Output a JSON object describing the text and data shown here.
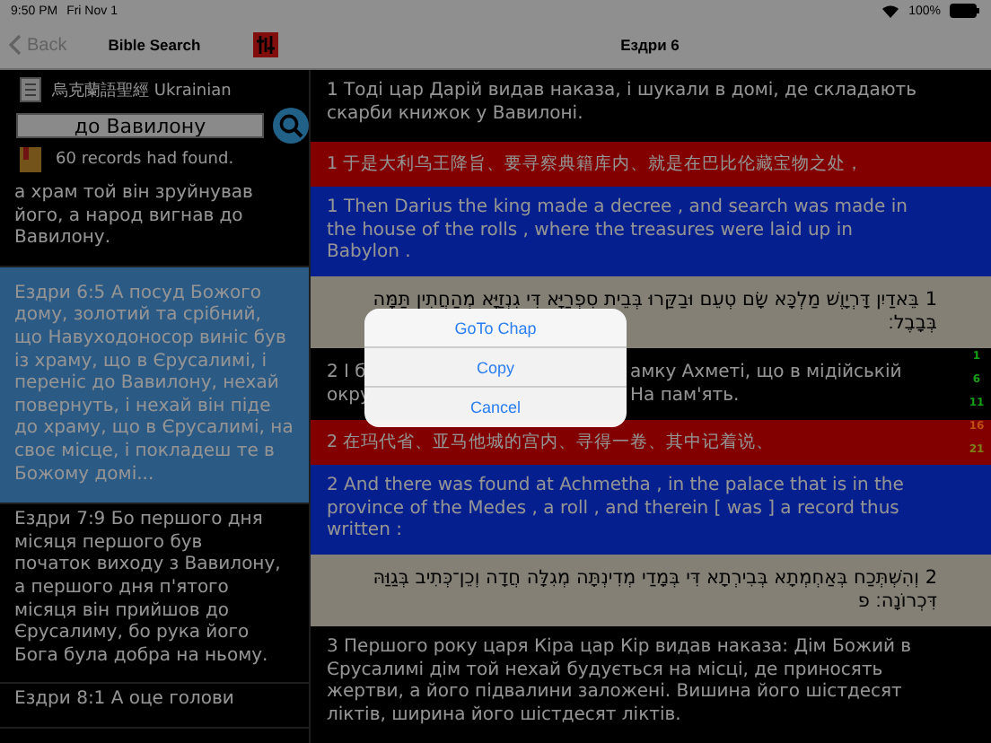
{
  "status_bar": {
    "time": "9:50 PM",
    "date": "Fri Nov 1",
    "battery": "100%"
  },
  "nav": {
    "back": "Back",
    "left_title": "Bible Search",
    "right_title": "Ездри 6"
  },
  "search": {
    "version": "烏克蘭語聖經 Ukrainian",
    "query": "до Вавилону",
    "result_count": "60 records had found."
  },
  "results": [
    {
      "text": "а храм той він зруйнував його, а народ вигнав до Вавилону.",
      "selected": false
    },
    {
      "text": "Ездри 6:5 А посуд Божого дому, золотий та срібний, що Навуходоносор виніс був із храму, що в Єрусалимі, і переніс до Вавилону, нехай повернуть, і нехай він піде до храму, що в Єрусалимі, на своє місце, і покладеш те в Божому домі...",
      "selected": true
    },
    {
      "text": "Ездри 7:9 Бо першого дня місяця першого був початок виходу з Вавилону, а першого дня п'ятого місяця він прийшов до Єрусалиму, бо рука його Бога була добра на ньому.",
      "selected": false
    },
    {
      "text": "Ездри 8:1 А оце голови",
      "selected": false
    }
  ],
  "verses": [
    {
      "kind": "ukrainian",
      "text": "1 Тоді цар Дарій видав наказа, і шукали в домі, де складають скарби книжок у Вавилоні."
    },
    {
      "kind": "chinese",
      "text": "1 于是大利乌王降旨、要寻察典籍库内、就是在巴比伦藏宝物之处，"
    },
    {
      "kind": "english",
      "text": "1 Then Darius the king made a decree , and search was made in the house of the rolls , where the treasures were laid up in Babylon ."
    },
    {
      "kind": "hebrew",
      "text": "1 בֵּאדַיִן דָּרְיָוֶשׁ מַלְכָּא שָׂם טְעֵם וּבַקַּרוּ בְּבֵית סִפְרַיָּא דִּי גִנְזַיָּא מְהַחֲתִין תַּמָּה בְּבָבֶל׃"
    },
    {
      "kind": "ukrainian",
      "fragments": {
        "left": [
          "2 І б",
          "окру"
        ],
        "right": [
          "амку Ахметі, що в мідійській",
          "На пам'ять."
        ]
      }
    },
    {
      "kind": "chinese",
      "text": "2 在玛代省、亚马他城的宫内、寻得一卷、其中记着说、"
    },
    {
      "kind": "english",
      "text": "2 And there was found at Achmetha , in the palace that is in the province of the Medes , a roll , and therein [ was ] a record thus written :"
    },
    {
      "kind": "hebrew",
      "text": "2 וְהִשְׁתְּכַח בְּאַחְמְתָא בְּבִירְתָא דִּי בְּמָדַי מְדִינְתָּה מְגִלָּה חֲדָה וְכֵן־כְּתִיב בְּגַוַּהּ דִּכְרוֹנָה׃ פ"
    },
    {
      "kind": "ukrainian",
      "text": "3 Першого року царя Кіра цар Кір видав наказа: Дім Божий в Єрусалимі дім той нехай будується на місці, де приносять жертви, а його підвалини заложені. Вишина його шістдесят ліктів, ширина його шістдесят ліктів."
    }
  ],
  "verse_index": [
    {
      "label": "1",
      "color": "#15a015"
    },
    {
      "label": "6",
      "color": "#15a015"
    },
    {
      "label": "11",
      "color": "#15a015"
    },
    {
      "label": "16",
      "color": "#c05010"
    },
    {
      "label": "21",
      "color": "#808018"
    }
  ],
  "action_sheet": {
    "buttons": [
      "GoTo Chap",
      "Copy",
      "Cancel"
    ]
  }
}
